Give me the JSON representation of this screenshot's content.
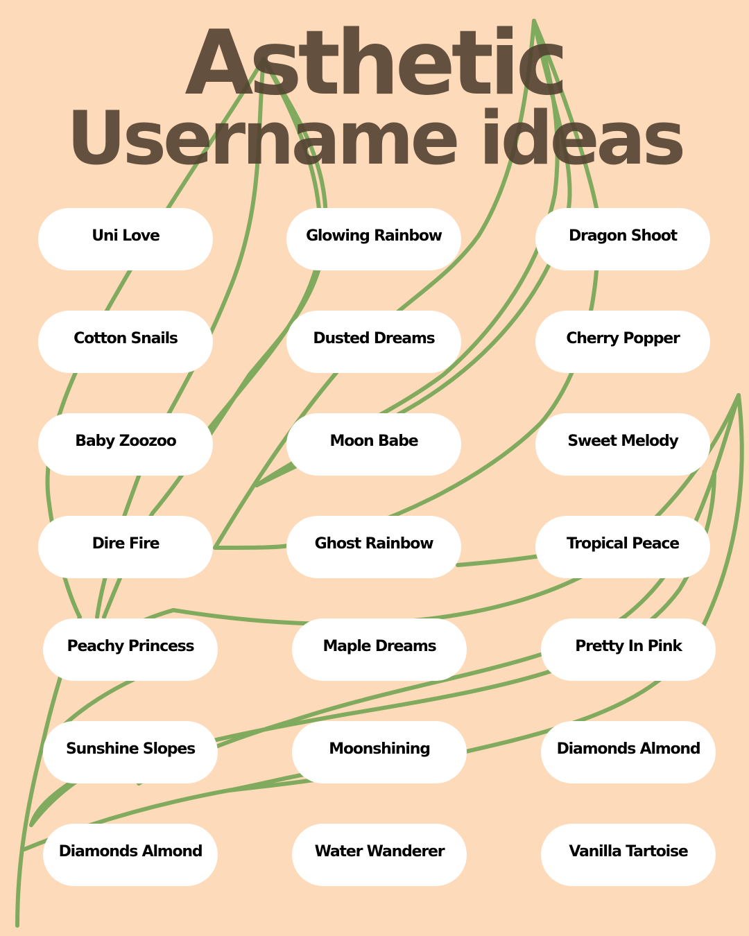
{
  "title": {
    "line1": "Asthetic",
    "line2": "Username ideas"
  },
  "colors": {
    "background": "#FDDAB9",
    "title": "#5E4B3E",
    "leaf_lines": "#80AA5E",
    "pill": "#FFFFFF",
    "pill_text": "#000000"
  },
  "decoration": {
    "icon": "leaf-outline-icon"
  },
  "usernames": [
    "Uni Love",
    "Glowing Rainbow",
    "Dragon Shoot",
    "Cotton Snails",
    "Dusted Dreams",
    "Cherry Popper",
    "Baby Zoozoo",
    "Moon Babe",
    "Sweet Melody",
    "Dire Fire",
    "Ghost Rainbow",
    "Tropical Peace",
    "Peachy Princess",
    "Maple Dreams",
    "Pretty In Pink",
    "Sunshine Slopes",
    "Moonshining",
    "Diamonds Almond",
    "Diamonds Almond",
    "Water Wanderer",
    "Vanilla Tartoise"
  ]
}
